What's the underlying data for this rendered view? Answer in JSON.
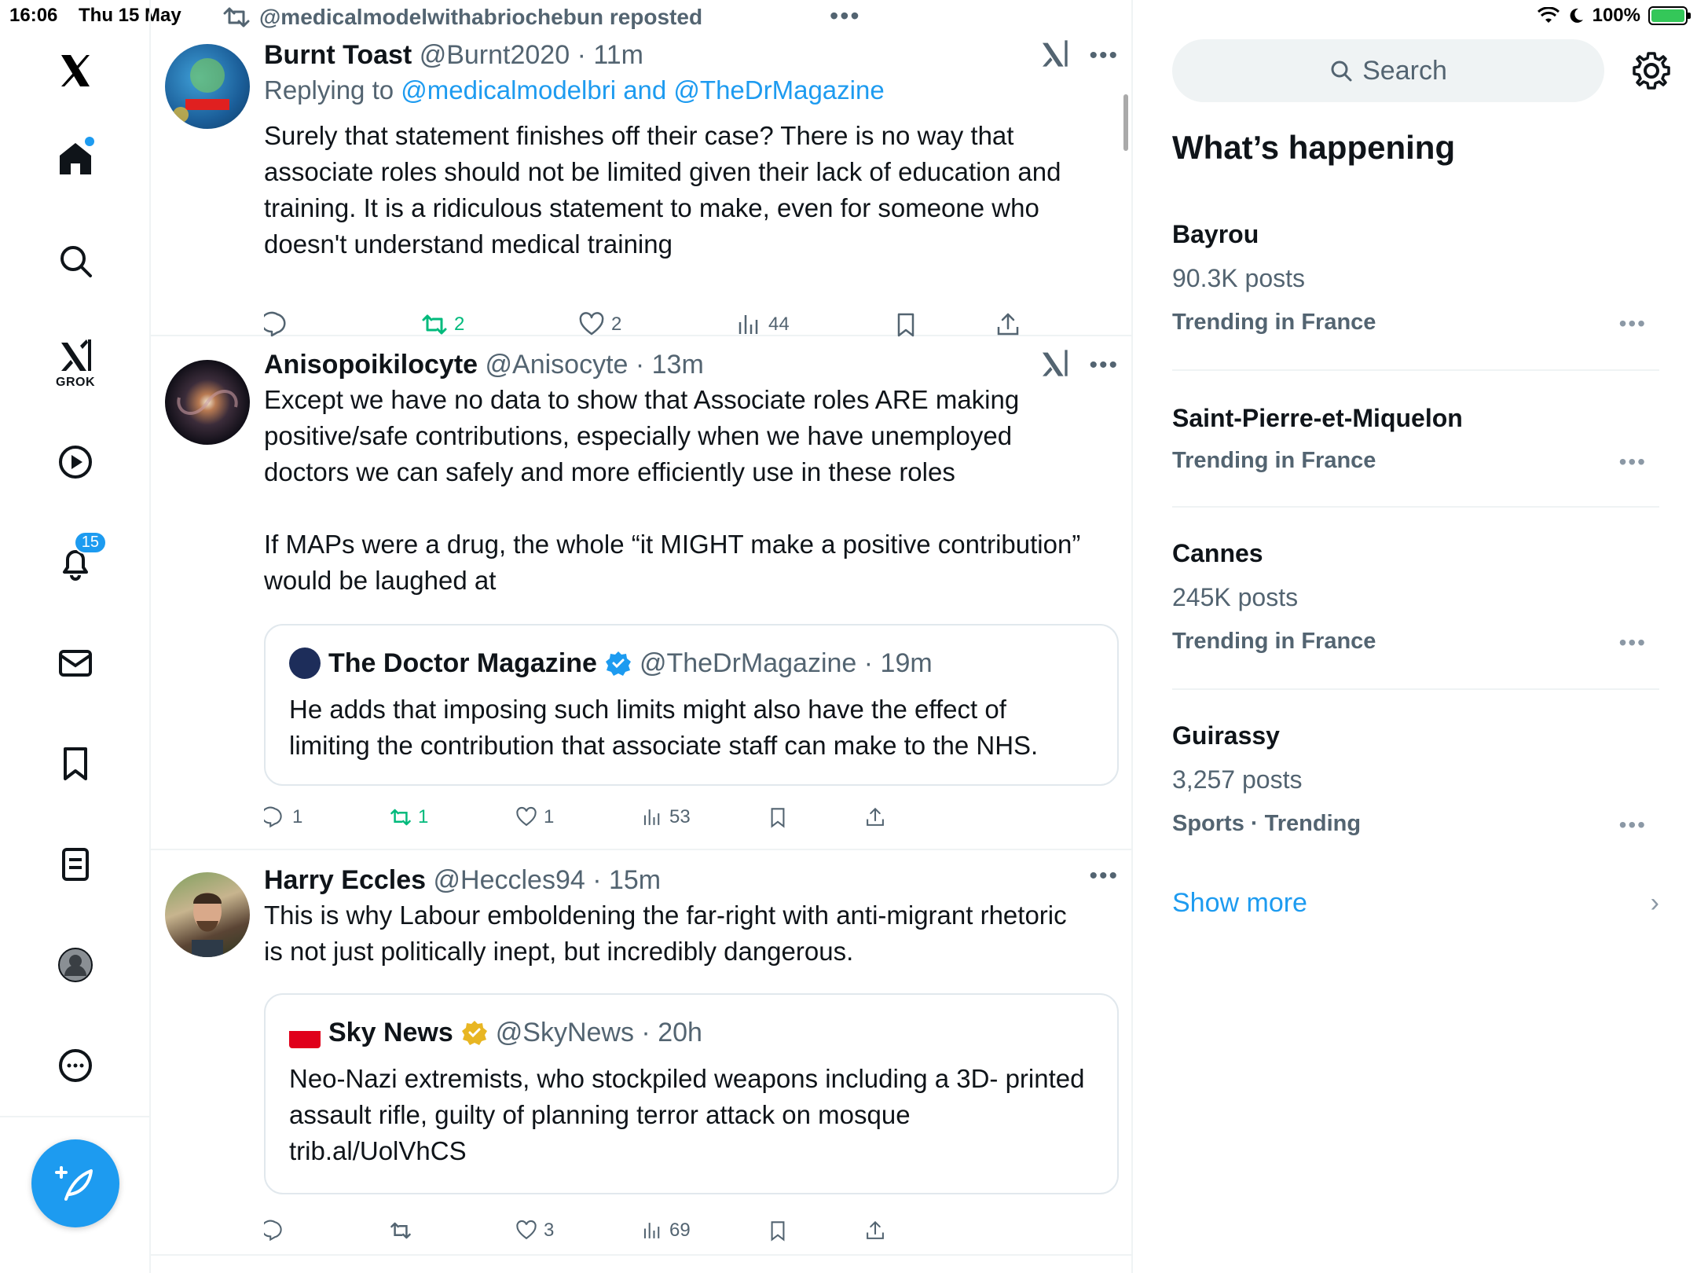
{
  "status": {
    "time": "16:06",
    "date": "Thu 15 May",
    "battery": "100%"
  },
  "nav": {
    "grok_label": "GROK",
    "notifications_count": "15"
  },
  "timeline": {
    "repost_label": "@medicalmodelwithabriochebun reposted",
    "tweets": [
      {
        "name": "Burnt Toast",
        "meta": "@Burnt2020 · 11m",
        "reply_prefix": "Replying to ",
        "reply_to": "@medicalmodelbri and @TheDrMagazine",
        "text": "Surely that statement finishes off their case? There is no way that\nassociate roles should not be limited given their lack of education and\ntraining. It is a ridiculous statement to make, even for someone who\ndoesn't understand medical training",
        "reposts": "2",
        "likes": "2",
        "views": "44"
      },
      {
        "name": "Anisopoikilocyte",
        "meta": "@Anisocyte · 13m",
        "text": "Except we have no data to show that Associate roles ARE making\npositive/safe contributions, especially when we have unemployed\ndoctors we can safely and more efficiently use in these roles\n\nIf MAPs were a drug, the whole “it MIGHT make a positive contribution”\nwould be laughed at",
        "replies": "1",
        "reposts": "1",
        "likes": "1",
        "views": "53",
        "quote": {
          "name": "The Doctor Magazine",
          "meta": "@TheDrMagazine · 19m",
          "text": "He adds that imposing such limits might also have the effect of\nlimiting the contribution that associate staff can make to the NHS."
        }
      },
      {
        "name": "Harry Eccles",
        "meta": "@Heccles94 · 15m",
        "text": "This is why Labour emboldening the far-right with anti-migrant rhetoric\nis not just politically inept, but incredibly dangerous.",
        "likes": "3",
        "views": "69",
        "quote": {
          "name": "Sky News",
          "meta": "@SkyNews · 20h",
          "text": "Neo-Nazi extremists, who stockpiled weapons including a 3D-\nprinted assault rifle, guilty of planning terror attack on mosque\ntrib.al/UolVhCS"
        }
      }
    ]
  },
  "sidebar": {
    "search_placeholder": "Search",
    "title": "What’s happening",
    "trends": [
      {
        "name": "Bayrou",
        "posts": "90.3K posts",
        "context": "Trending in France"
      },
      {
        "name": "Saint-Pierre-et-Miquelon",
        "context": "Trending in France"
      },
      {
        "name": "Cannes",
        "posts": "245K posts",
        "context": "Trending in France"
      },
      {
        "name": "Guirassy",
        "posts": "3,257 posts",
        "context": "Sports · Trending"
      }
    ],
    "show_more": "Show more"
  },
  "colors": {
    "accent": "#1d9bf0",
    "repost_green": "#00ba7c",
    "muted": "#536471"
  }
}
